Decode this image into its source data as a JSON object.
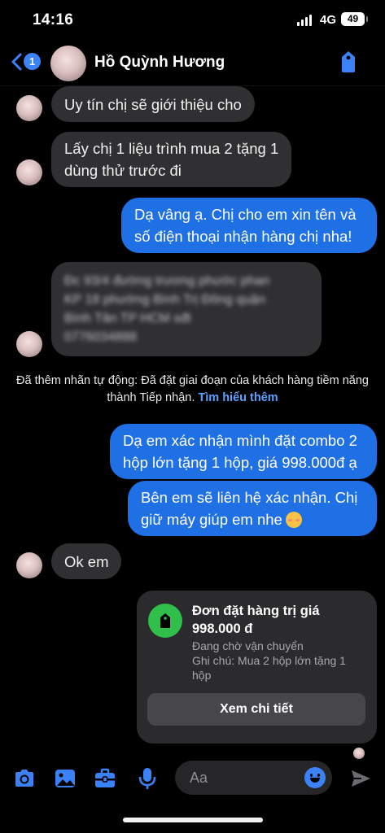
{
  "status_bar": {
    "time": "14:16",
    "network": "4G",
    "battery": "49"
  },
  "header": {
    "back_badge": "1",
    "contact_name": "Hồ Quỳnh Hương"
  },
  "messages": [
    {
      "direction": "in",
      "lines": [
        "Uy tín chị sẽ giới thiệu cho"
      ]
    },
    {
      "direction": "in",
      "lines": [
        "Lấy chị 1 liệu trình mua 2 tặng 1",
        "dùng thử trước đi"
      ]
    },
    {
      "direction": "out",
      "lines": [
        "Dạ vâng ạ. Chị cho em xin tên và",
        "số điện thoại nhận hàng chị nha!"
      ]
    },
    {
      "direction": "in",
      "blurred": true,
      "lines": [
        "Đc 93/4 đường trương phước phan",
        "KP 18 phường Bình Trị Đông quận",
        "Bình Tân TP HCM sđt",
        "0776034888"
      ]
    },
    {
      "direction": "out",
      "lines": [
        "Dạ em xác nhận mình đặt combo 2",
        "hộp lớn tặng 1 hộp, giá 998.000đ ạ"
      ]
    },
    {
      "direction": "out",
      "lines": [
        "Bên em sẽ liên hệ xác nhận. Chị",
        "giữ máy giúp em nhe"
      ]
    },
    {
      "direction": "in",
      "lines": [
        "Ok em"
      ]
    }
  ],
  "system_note": {
    "text": "Đã thêm nhãn tự động: Đã đặt giai đoạn của khách hàng tiềm năng thành Tiếp nhận.",
    "link": "Tìm hiểu thêm"
  },
  "order_card": {
    "title": "Đơn đặt hàng trị giá 998.000 đ",
    "status": "Đang chờ vận chuyển",
    "note": "Ghi chú: Mua 2 hộp lớn tặng 1 hộp",
    "button": "Xem chi tiết"
  },
  "composer": {
    "placeholder": "Aa"
  },
  "icons": [
    "camera-icon",
    "image-icon",
    "briefcase-icon",
    "microphone-icon",
    "emoji-icon",
    "send-icon",
    "tag-icon",
    "back-chevron-icon"
  ],
  "colors": {
    "accent": "#3b82f6",
    "outgoing_bubble": "#1f6fe5",
    "incoming_bubble": "#303033",
    "order_icon": "#2fbf4a"
  }
}
